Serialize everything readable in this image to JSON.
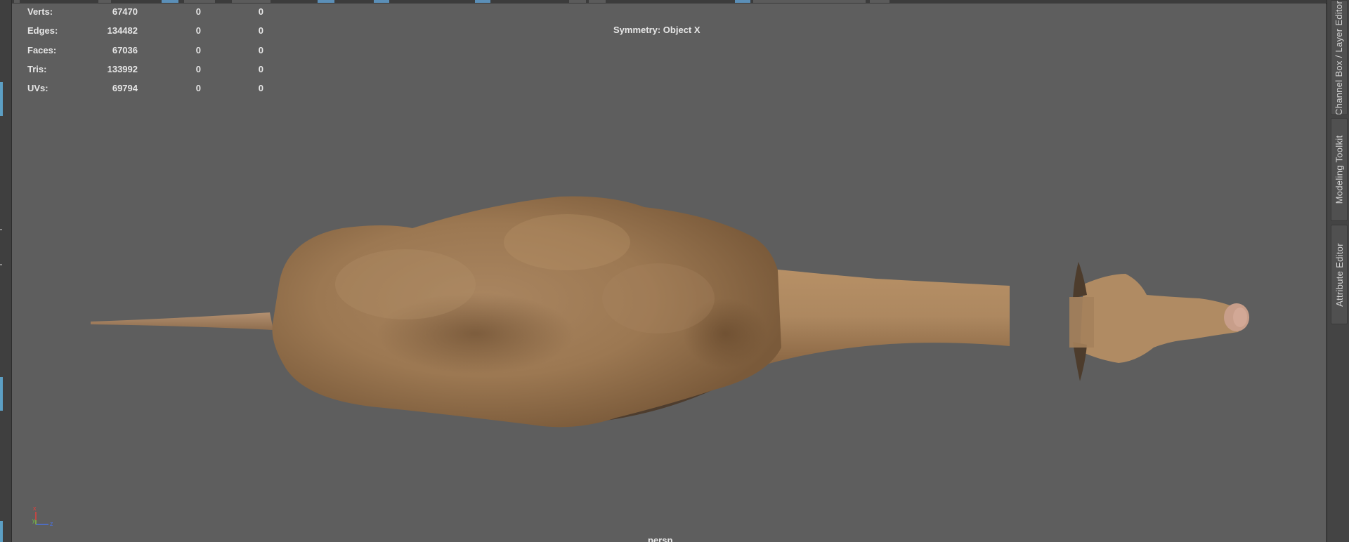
{
  "viewport": {
    "symmetry": "Symmetry: Object X",
    "camera": "persp",
    "background_color": "#5e5e5e"
  },
  "hud": {
    "rows": [
      {
        "label": "Verts:",
        "values": [
          "67470",
          "0",
          "0"
        ]
      },
      {
        "label": "Edges:",
        "values": [
          "134482",
          "0",
          "0"
        ]
      },
      {
        "label": "Faces:",
        "values": [
          "67036",
          "0",
          "0"
        ]
      },
      {
        "label": "Tris:",
        "values": [
          "133992",
          "0",
          "0"
        ]
      },
      {
        "label": "UVs:",
        "values": [
          "69794",
          "0",
          "0"
        ]
      }
    ]
  },
  "axis_gizmo": {
    "x": "x",
    "y": "y",
    "z": "z",
    "x_color": "#e0413b",
    "y_color": "#6cc24a",
    "z_color": "#4a72e0"
  },
  "right_panel": {
    "tabs": [
      {
        "label": "Channel Box / Layer Editor"
      },
      {
        "label": "Modeling Toolkit"
      },
      {
        "label": "Attribute Editor"
      }
    ]
  },
  "colors": {
    "accent": "#5c9fc4",
    "model_skin": "#a9835c"
  }
}
